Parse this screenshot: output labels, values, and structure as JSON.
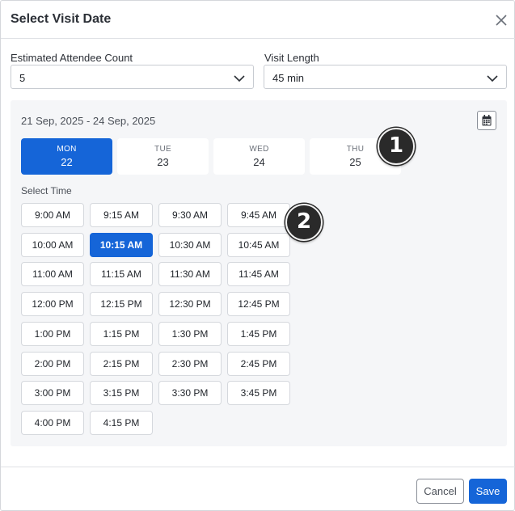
{
  "dialog": {
    "title": "Select Visit Date"
  },
  "attendee": {
    "label": "Estimated Attendee Count",
    "value": "5"
  },
  "visit_length": {
    "label": "Visit Length",
    "value": "45 min"
  },
  "date_range": "21 Sep, 2025 - 24 Sep, 2025",
  "days": [
    {
      "name": "MON",
      "date": "22",
      "selected": true
    },
    {
      "name": "TUE",
      "date": "23",
      "selected": false
    },
    {
      "name": "WED",
      "date": "24",
      "selected": false
    },
    {
      "name": "THU",
      "date": "25",
      "selected": false
    }
  ],
  "select_time_label": "Select Time",
  "time_slots": [
    "9:00 AM",
    "9:15 AM",
    "9:30 AM",
    "9:45 AM",
    "10:00 AM",
    "10:15 AM",
    "10:30 AM",
    "10:45 AM",
    "11:00 AM",
    "11:15 AM",
    "11:30 AM",
    "11:45 AM",
    "12:00 PM",
    "12:15 PM",
    "12:30 PM",
    "12:45 PM",
    "1:00 PM",
    "1:15 PM",
    "1:30 PM",
    "1:45 PM",
    "2:00 PM",
    "2:15 PM",
    "2:30 PM",
    "2:45 PM",
    "3:00 PM",
    "3:15 PM",
    "3:30 PM",
    "3:45 PM",
    "4:00 PM",
    "4:15 PM"
  ],
  "selected_time": "10:15 AM",
  "badges": {
    "one": "1",
    "two": "2"
  },
  "footer": {
    "cancel_label": "Cancel",
    "save_label": "Save"
  },
  "colors": {
    "accent": "#1565d8",
    "panel_bg": "#f5f6f8",
    "badge": "#2a2a2a"
  },
  "icons": {
    "close": "close-icon",
    "chevron": "chevron-down-icon",
    "calendar": "calendar-icon"
  }
}
